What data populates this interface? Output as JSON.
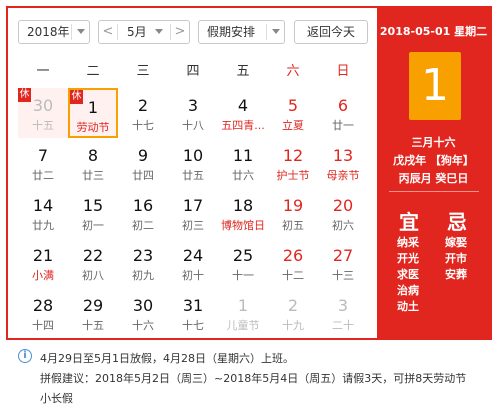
{
  "toolbar": {
    "year": "2018年",
    "month": "5月",
    "prev_arrow": "<",
    "next_arrow": ">",
    "holiday_select": "假期安排",
    "today_button": "返回今天"
  },
  "weekdays": [
    "一",
    "二",
    "三",
    "四",
    "五",
    "六",
    "日"
  ],
  "weeks": [
    [
      {
        "day": "30",
        "lunar": "十五",
        "other": true,
        "badge": "休",
        "holiday": true
      },
      {
        "day": "1",
        "lunar": "劳动节",
        "lunar_red": true,
        "badge": "休",
        "holiday": true,
        "selected": true
      },
      {
        "day": "2",
        "lunar": "十七"
      },
      {
        "day": "3",
        "lunar": "十八"
      },
      {
        "day": "4",
        "lunar": "五四青...",
        "lunar_red": true
      },
      {
        "day": "5",
        "lunar": "立夏",
        "lunar_red": true,
        "weekend": true
      },
      {
        "day": "6",
        "lunar": "廿一",
        "weekend": true
      }
    ],
    [
      {
        "day": "7",
        "lunar": "廿二"
      },
      {
        "day": "8",
        "lunar": "廿三"
      },
      {
        "day": "9",
        "lunar": "廿四"
      },
      {
        "day": "10",
        "lunar": "廿五"
      },
      {
        "day": "11",
        "lunar": "廿六"
      },
      {
        "day": "12",
        "lunar": "护士节",
        "lunar_red": true,
        "weekend": true
      },
      {
        "day": "13",
        "lunar": "母亲节",
        "lunar_red": true,
        "weekend": true
      }
    ],
    [
      {
        "day": "14",
        "lunar": "廿九"
      },
      {
        "day": "15",
        "lunar": "初一"
      },
      {
        "day": "16",
        "lunar": "初二"
      },
      {
        "day": "17",
        "lunar": "初三"
      },
      {
        "day": "18",
        "lunar": "博物馆日",
        "lunar_red": true
      },
      {
        "day": "19",
        "lunar": "初五",
        "weekend": true
      },
      {
        "day": "20",
        "lunar": "初六",
        "weekend": true
      }
    ],
    [
      {
        "day": "21",
        "lunar": "小满",
        "lunar_red": true
      },
      {
        "day": "22",
        "lunar": "初八"
      },
      {
        "day": "23",
        "lunar": "初九"
      },
      {
        "day": "24",
        "lunar": "初十"
      },
      {
        "day": "25",
        "lunar": "十一"
      },
      {
        "day": "26",
        "lunar": "十二",
        "weekend": true
      },
      {
        "day": "27",
        "lunar": "十三",
        "weekend": true
      }
    ],
    [
      {
        "day": "28",
        "lunar": "十四"
      },
      {
        "day": "29",
        "lunar": "十五"
      },
      {
        "day": "30",
        "lunar": "十六"
      },
      {
        "day": "31",
        "lunar": "十七"
      },
      {
        "day": "1",
        "lunar": "儿童节",
        "other": true
      },
      {
        "day": "2",
        "lunar": "十九",
        "other": true
      },
      {
        "day": "3",
        "lunar": "二十",
        "other": true
      }
    ]
  ],
  "detail": {
    "date_header": "2018-05-01 星期二",
    "big_day": "1",
    "lunar_date": "三月十六",
    "year_ganzhi": "戊戌年 【狗年】",
    "month_day_ganzhi": "丙辰月 癸巳日",
    "yi_title": "宜",
    "ji_title": "忌",
    "yi_items": [
      "纳采",
      "开光",
      "求医",
      "治病",
      "动土"
    ],
    "ji_items": [
      "嫁娶",
      "开市",
      "安葬"
    ]
  },
  "info": {
    "icon": "i",
    "line1": "4月29日至5月1日放假，4月28日（星期六）上班。",
    "line2": "拼假建议：2018年5月2日（周三）~2018年5月4日（周五）请假3天，可拼8天劳动节",
    "line3": "小长假"
  },
  "colors": {
    "accent_red": "#e0261f",
    "today_orange": "#f7a000",
    "info_blue": "#4a90d9"
  }
}
